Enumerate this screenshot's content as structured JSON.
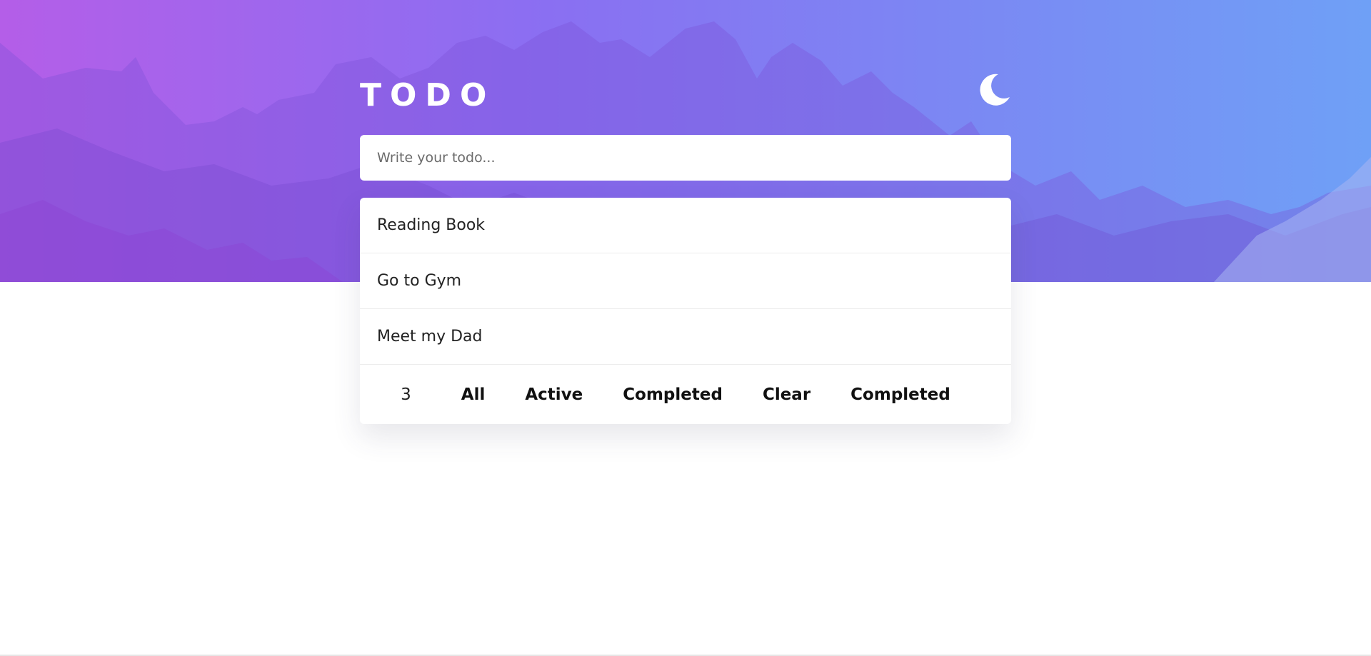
{
  "app": {
    "title": "TODO",
    "theme_icon": "moon-icon"
  },
  "input": {
    "placeholder": "Write your todo...",
    "value": ""
  },
  "todos": [
    {
      "label": "Reading Book"
    },
    {
      "label": "Go to Gym"
    },
    {
      "label": "Meet my Dad"
    }
  ],
  "footer": {
    "count": "3",
    "filters": {
      "all": "All",
      "active": "Active",
      "completed": "Completed"
    },
    "clear_label": "Clear",
    "clear_sub_label": "Completed"
  },
  "colors": {
    "gradient_start": "#b45ee8",
    "gradient_end": "#6fa0f6",
    "card_bg": "#ffffff",
    "text": "#222222"
  }
}
